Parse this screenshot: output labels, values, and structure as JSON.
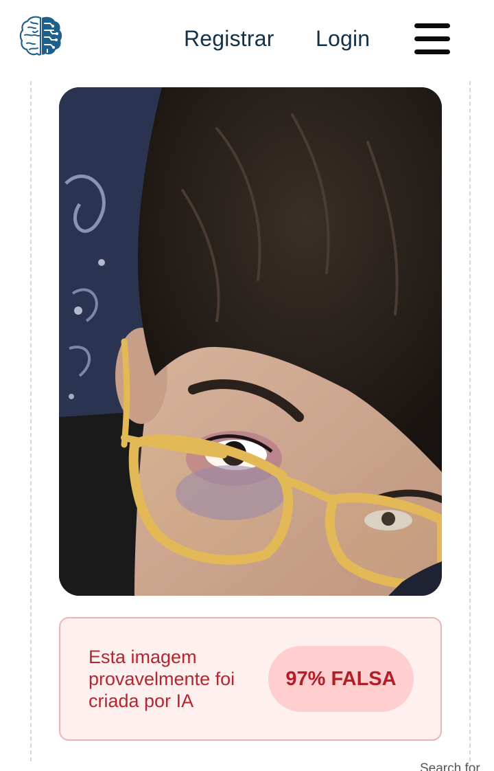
{
  "header": {
    "logo_icon": "brain-logo-icon",
    "register_label": "Registrar",
    "login_label": "Login",
    "menu_icon": "hamburger-menu-icon"
  },
  "main": {
    "photo": {
      "subject": "uploaded-photo"
    },
    "result": {
      "message": "Esta imagem provavelmente foi criada por IA",
      "verdict": "97% FALSA",
      "probability_percent": 97
    }
  },
  "footer": {
    "search_peek": "Search for"
  },
  "colors": {
    "nav_text": "#123048",
    "logo_blue": "#1f5f8b",
    "result_bg": "#fff0f0",
    "result_border": "#e8b4b4",
    "result_text": "#b3262d",
    "badge_bg": "#ffcfcf"
  }
}
